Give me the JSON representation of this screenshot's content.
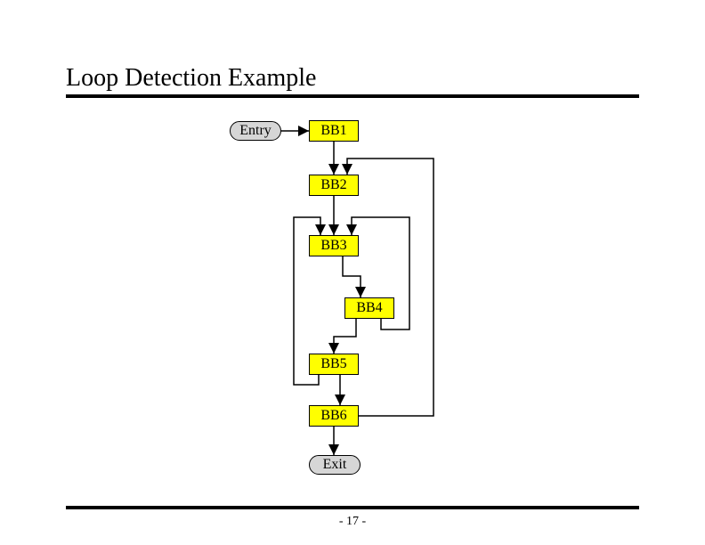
{
  "title": "Loop Detection Example",
  "footer": "- 17 -",
  "nodes": {
    "entry": "Entry",
    "bb1": "BB1",
    "bb2": "BB2",
    "bb3": "BB3",
    "bb4": "BB4",
    "bb5": "BB5",
    "bb6": "BB6",
    "exit": "Exit"
  },
  "edges": [
    {
      "from": "entry",
      "to": "bb1"
    },
    {
      "from": "bb1",
      "to": "bb2"
    },
    {
      "from": "bb2",
      "to": "bb3"
    },
    {
      "from": "bb3",
      "to": "bb4"
    },
    {
      "from": "bb4",
      "to": "bb3"
    },
    {
      "from": "bb4",
      "to": "bb5"
    },
    {
      "from": "bb5",
      "to": "bb3"
    },
    {
      "from": "bb5",
      "to": "bb6"
    },
    {
      "from": "bb6",
      "to": "bb2"
    },
    {
      "from": "bb6",
      "to": "exit"
    }
  ]
}
